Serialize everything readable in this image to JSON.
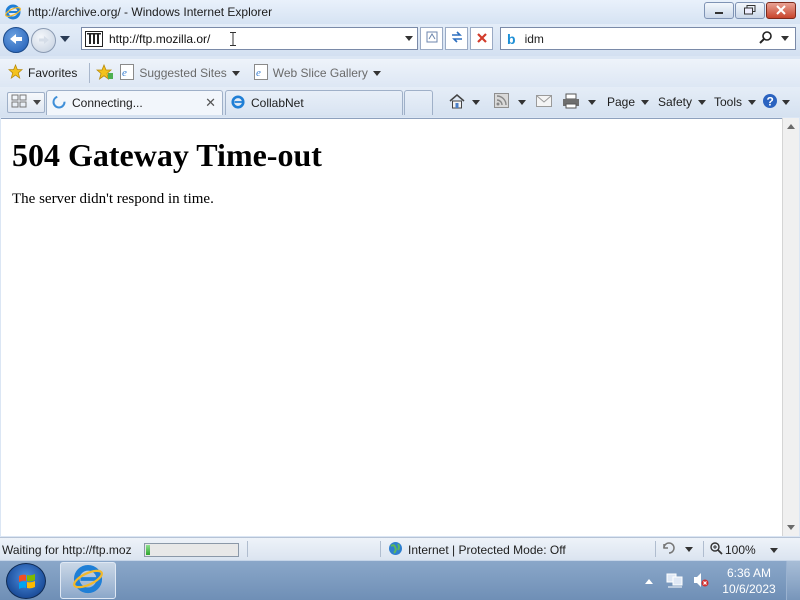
{
  "window": {
    "title": "http://archive.org/ - Windows Internet Explorer"
  },
  "navigation": {
    "address": "http://ftp.mozilla.or/",
    "search_text": "idm"
  },
  "favorites_bar": {
    "favorites_label": "Favorites",
    "suggested_sites_label": "Suggested Sites",
    "web_slice_gallery_label": "Web Slice Gallery"
  },
  "tabs": [
    {
      "label": "Connecting...",
      "active": true
    },
    {
      "label": "CollabNet",
      "active": false
    }
  ],
  "command_bar": {
    "page_label": "Page",
    "safety_label": "Safety",
    "tools_label": "Tools"
  },
  "page": {
    "heading": "504 Gateway Time-out",
    "message": "The server didn't respond in time."
  },
  "status_bar": {
    "status_text": "Waiting for http://ftp.moz",
    "progress_fraction": 0.04,
    "zone_text": "Internet | Protected Mode: Off",
    "zoom_text": "100%"
  },
  "taskbar": {
    "time": "6:36 AM",
    "date": "10/6/2023"
  },
  "colors": {
    "accent_blue": "#1e5bb5",
    "close_red": "#c8442c",
    "progress_green": "#2ea52e"
  },
  "icons": [
    "ie-logo-icon",
    "back-arrow-icon",
    "forward-arrow-icon",
    "compatibility-icon",
    "refresh-icon",
    "stop-icon",
    "bing-icon",
    "search-icon",
    "favorites-star-icon",
    "add-favorite-icon",
    "quick-tabs-icon",
    "loading-icon",
    "home-icon",
    "feeds-icon",
    "mail-icon",
    "print-icon",
    "help-icon",
    "globe-icon",
    "windows-start-icon",
    "network-icon",
    "volume-muted-icon"
  ]
}
